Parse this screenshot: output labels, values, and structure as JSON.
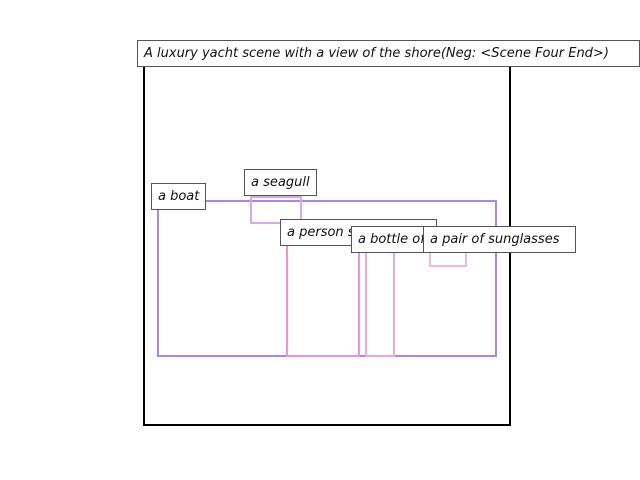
{
  "title": "A luxury yacht scene with a view of the shore(Neg: <Scene Four End>)",
  "objects": [
    {
      "id": "boat",
      "label": "a boat",
      "color": "#b084e6"
    },
    {
      "id": "seagull",
      "label": "a seagull",
      "color": "#d9a6f2"
    },
    {
      "id": "person",
      "label": "a person sunbathing",
      "color": "#f08fdb"
    },
    {
      "id": "bottle",
      "label": "a bottle of sunscreen",
      "color": "#eea6dd"
    },
    {
      "id": "sunglasses",
      "label": "a pair of sunglasses",
      "color": "#f6b8d8"
    }
  ]
}
